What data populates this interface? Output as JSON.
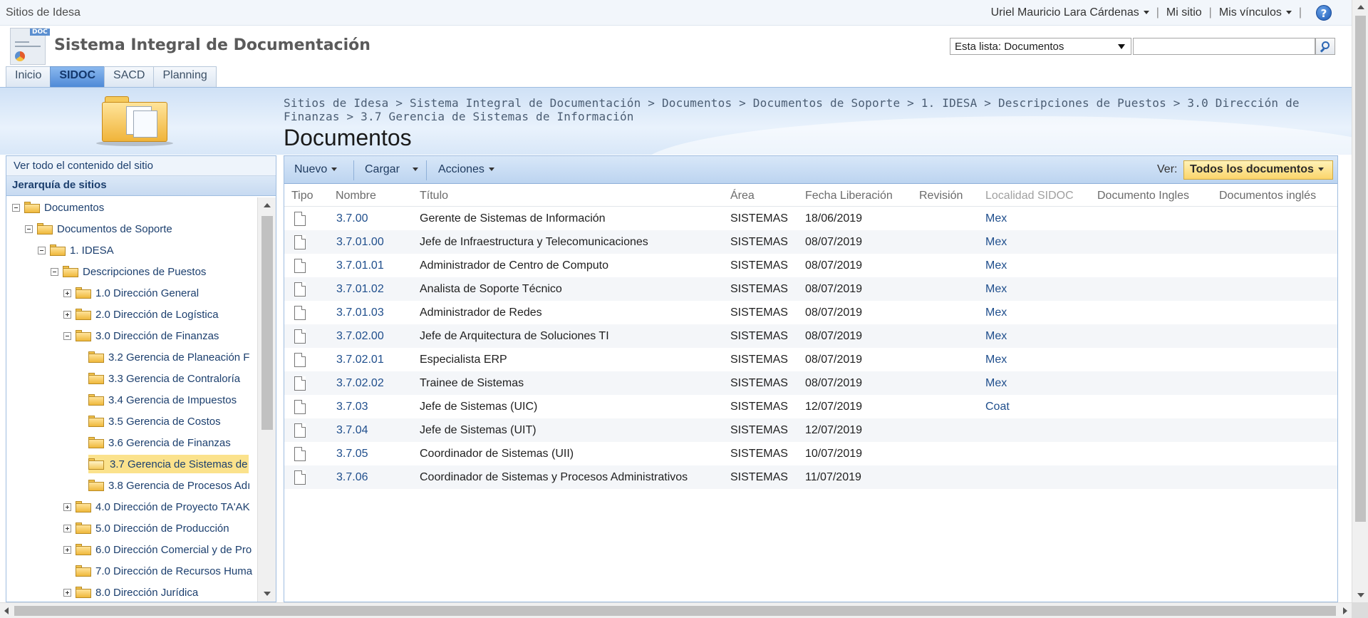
{
  "topbar": {
    "site_label": "Sitios de Idesa",
    "user_name": "Uriel Mauricio Lara Cárdenas",
    "my_site": "Mi sitio",
    "my_links": "Mis vínculos",
    "separator": "|",
    "help_glyph": "?"
  },
  "header": {
    "logo_badge": "DOC",
    "site_title": "Sistema Integral de Documentación",
    "search_scope": "Esta lista: Documentos",
    "search_placeholder": ""
  },
  "tabs": [
    {
      "label": "Inicio",
      "active": false
    },
    {
      "label": "SIDOC",
      "active": true
    },
    {
      "label": "SACD",
      "active": false
    },
    {
      "label": "Planning",
      "active": false
    }
  ],
  "title_area": {
    "breadcrumb": "Sitios de Idesa > Sistema Integral de Documentación > Documentos > Documentos de Soporte > 1. IDESA > Descripciones de Puestos > 3.0 Dirección de Finanzas > 3.7 Gerencia de Sistemas de Información",
    "page_title": "Documentos"
  },
  "leftnav": {
    "view_all": "Ver todo el contenido del sitio",
    "hierarchy_heading": "Jerarquía de sitios",
    "tree": [
      {
        "label": "Documentos",
        "level": 0,
        "toggle": "minus",
        "selected": false
      },
      {
        "label": "Documentos de Soporte",
        "level": 1,
        "toggle": "minus",
        "selected": false
      },
      {
        "label": "1. IDESA",
        "level": 2,
        "toggle": "minus",
        "selected": false
      },
      {
        "label": "Descripciones de Puestos",
        "level": 3,
        "toggle": "minus",
        "selected": false
      },
      {
        "label": "1.0 Dirección General",
        "level": 4,
        "toggle": "plus",
        "selected": false
      },
      {
        "label": "2.0 Dirección de Logística",
        "level": 4,
        "toggle": "plus",
        "selected": false
      },
      {
        "label": "3.0 Dirección de Finanzas",
        "level": 4,
        "toggle": "minus",
        "selected": false
      },
      {
        "label": "3.2 Gerencia de Planeación F",
        "level": 5,
        "toggle": "none",
        "selected": false
      },
      {
        "label": "3.3 Gerencia de Contraloría",
        "level": 5,
        "toggle": "none",
        "selected": false
      },
      {
        "label": "3.4 Gerencia de Impuestos",
        "level": 5,
        "toggle": "none",
        "selected": false
      },
      {
        "label": "3.5 Gerencia de Costos",
        "level": 5,
        "toggle": "none",
        "selected": false
      },
      {
        "label": "3.6 Gerencia de Finanzas",
        "level": 5,
        "toggle": "none",
        "selected": false
      },
      {
        "label": "3.7 Gerencia de Sistemas de",
        "level": 5,
        "toggle": "none",
        "selected": true
      },
      {
        "label": "3.8 Gerencia de Procesos Adı",
        "level": 5,
        "toggle": "none",
        "selected": false
      },
      {
        "label": "4.0 Dirección de Proyecto TA'AK",
        "level": 4,
        "toggle": "plus",
        "selected": false
      },
      {
        "label": "5.0 Dirección de Producción",
        "level": 4,
        "toggle": "plus",
        "selected": false
      },
      {
        "label": "6.0 Dirección Comercial y de Pro",
        "level": 4,
        "toggle": "plus",
        "selected": false
      },
      {
        "label": "7.0 Dirección de Recursos Huma",
        "level": 4,
        "toggle": "none",
        "selected": false
      },
      {
        "label": "8.0 Dirección Jurídica",
        "level": 4,
        "toggle": "plus",
        "selected": false
      }
    ]
  },
  "toolbar": {
    "new_label": "Nuevo",
    "upload_label": "Cargar",
    "actions_label": "Acciones",
    "view_label": "Ver:",
    "view_value": "Todos los documentos"
  },
  "table": {
    "columns": [
      "Tipo",
      "Nombre",
      "Título",
      "Área",
      "Fecha Liberación",
      "Revisión",
      "Localidad SIDOC",
      "Documento Ingles",
      "Documentos inglés"
    ],
    "rows": [
      {
        "name": "3.7.00",
        "title": "Gerente de Sistemas de Información",
        "area": "SISTEMAS",
        "date": "18/06/2019",
        "locality": "Mex"
      },
      {
        "name": "3.7.01.00",
        "title": "Jefe de Infraestructura y Telecomunicaciones",
        "area": "SISTEMAS",
        "date": "08/07/2019",
        "locality": "Mex"
      },
      {
        "name": "3.7.01.01",
        "title": "Administrador de Centro de Computo",
        "area": "SISTEMAS",
        "date": "08/07/2019",
        "locality": "Mex"
      },
      {
        "name": "3.7.01.02",
        "title": "Analista de Soporte Técnico",
        "area": "SISTEMAS",
        "date": "08/07/2019",
        "locality": "Mex"
      },
      {
        "name": "3.7.01.03",
        "title": "Administrador de Redes",
        "area": "SISTEMAS",
        "date": "08/07/2019",
        "locality": "Mex"
      },
      {
        "name": "3.7.02.00",
        "title": "Jefe de Arquitectura de Soluciones TI",
        "area": "SISTEMAS",
        "date": "08/07/2019",
        "locality": "Mex"
      },
      {
        "name": "3.7.02.01",
        "title": "Especialista ERP",
        "area": "SISTEMAS",
        "date": "08/07/2019",
        "locality": "Mex"
      },
      {
        "name": "3.7.02.02",
        "title": "Trainee de Sistemas",
        "area": "SISTEMAS",
        "date": "08/07/2019",
        "locality": "Mex"
      },
      {
        "name": "3.7.03",
        "title": "Jefe de Sistemas (UIC)",
        "area": "SISTEMAS",
        "date": "12/07/2019",
        "locality": "Coat"
      },
      {
        "name": "3.7.04",
        "title": "Jefe de Sistemas (UIT)",
        "area": "SISTEMAS",
        "date": "12/07/2019",
        "locality": ""
      },
      {
        "name": "3.7.05",
        "title": "Coordinador de Sistemas (UII)",
        "area": "SISTEMAS",
        "date": "10/07/2019",
        "locality": ""
      },
      {
        "name": "3.7.06",
        "title": "Coordinador de Sistemas y Procesos Administrativos",
        "area": "SISTEMAS",
        "date": "11/07/2019",
        "locality": ""
      }
    ]
  },
  "colors": {
    "accent": "#4f8ad7",
    "link": "#1f4e8c",
    "selected_highlight": "#fbe28c"
  },
  "icons": {
    "help": "help-icon",
    "search": "search-icon",
    "folder": "folder-icon",
    "document": "document-icon"
  }
}
